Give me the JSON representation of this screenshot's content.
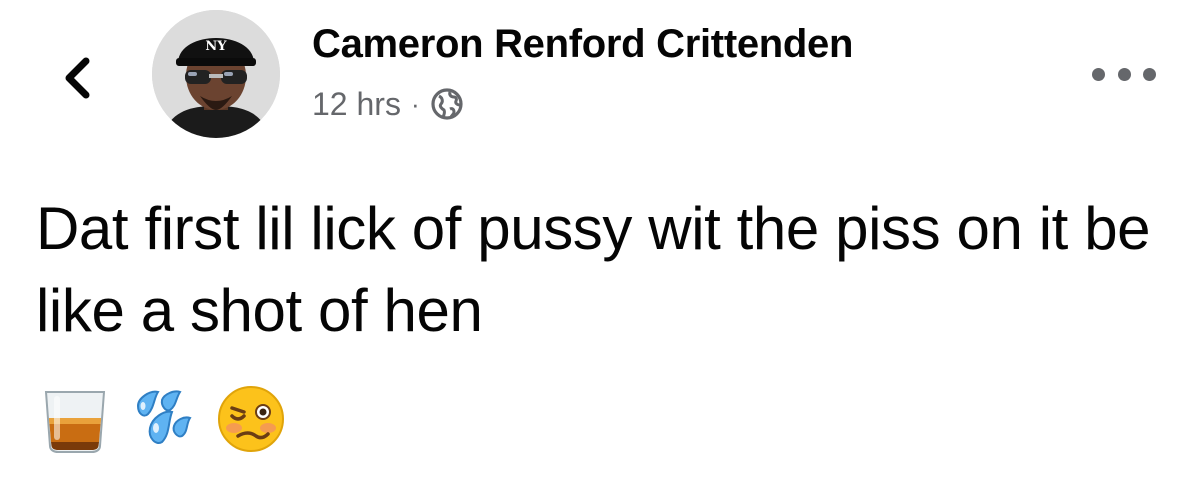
{
  "header": {
    "back_icon": "chevron-left-icon",
    "author_name": "Cameron Renford Crittenden",
    "timestamp": "12 hrs",
    "separator": "·",
    "audience_icon": "globe-icon",
    "more_icon": "more-horizontal-icon"
  },
  "post": {
    "text": "Dat first lil lick of pussy wit the piss on it be like a shot of hen",
    "emojis": [
      "tumbler-glass-icon",
      "sweat-droplets-icon",
      "woozy-face-icon"
    ]
  },
  "colors": {
    "text_primary": "#050505",
    "text_secondary": "#65676b"
  }
}
